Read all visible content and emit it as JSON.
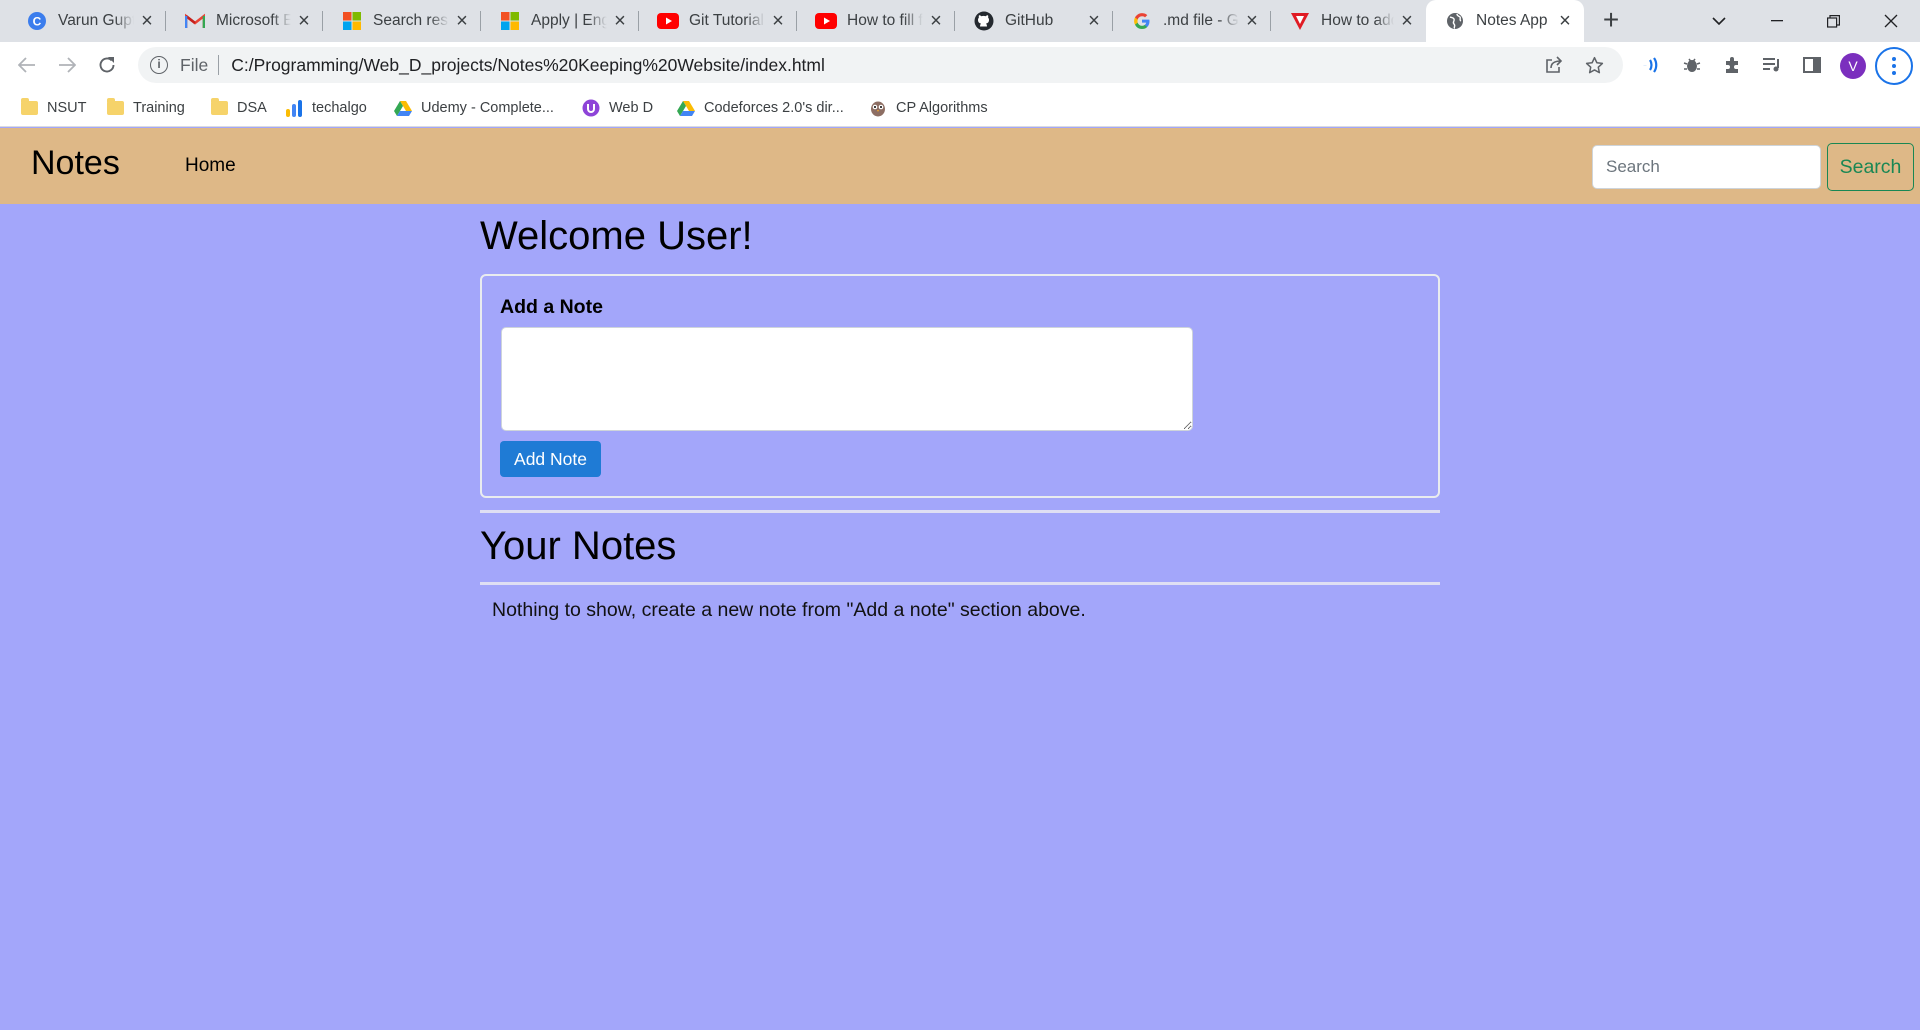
{
  "browser": {
    "tabs": [
      {
        "title": "Varun Gupta",
        "icon": "copilot-icon",
        "active": false
      },
      {
        "title": "Microsoft Edge",
        "icon": "gmail-icon",
        "active": false
      },
      {
        "title": "Search results",
        "icon": "microsoft-icon",
        "active": false
      },
      {
        "title": "Apply | Engage",
        "icon": "microsoft-icon",
        "active": false
      },
      {
        "title": "Git Tutorial",
        "icon": "youtube-icon",
        "active": false
      },
      {
        "title": "How to fill f",
        "icon": "youtube-icon",
        "active": false
      },
      {
        "title": "GitHub",
        "icon": "github-icon",
        "active": false
      },
      {
        "title": ".md file - Google",
        "icon": "google-icon",
        "active": false
      },
      {
        "title": "How to add",
        "icon": "vercel-icon",
        "active": false
      },
      {
        "title": "Notes App",
        "icon": "globe-icon",
        "active": true
      }
    ],
    "address": {
      "scheme": "File",
      "url": "C:/Programming/Web_D_projects/Notes%20Keeping%20Website/index.html"
    },
    "profile_initial": "V",
    "bookmarks": [
      {
        "label": "NSUT",
        "icon": "folder-icon"
      },
      {
        "label": "Training",
        "icon": "folder-icon"
      },
      {
        "label": "DSA",
        "icon": "folder-icon"
      },
      {
        "label": "techalgo",
        "icon": "bar-chart-icon"
      },
      {
        "label": "Udemy - Complete...",
        "icon": "google-drive-icon"
      },
      {
        "label": "Web D",
        "icon": "purple-badge-icon"
      },
      {
        "label": "Codeforces 2.0's dir...",
        "icon": "google-drive-icon"
      },
      {
        "label": "CP Algorithms",
        "icon": "owl-icon"
      }
    ]
  },
  "navbar": {
    "brand": "Notes",
    "home": "Home",
    "search_placeholder": "Search",
    "search_button": "Search"
  },
  "main": {
    "welcome": "Welcome User!",
    "add_note_title": "Add a Note",
    "add_note_button": "Add Note",
    "your_notes_title": "Your Notes",
    "empty_message": "Nothing to show, create a new note from \"Add a note\" section above."
  },
  "colors": {
    "page_bg": "#a3a6fa",
    "navbar_bg": "#deb887",
    "accent": "#1f7bd5",
    "success": "#198754"
  }
}
